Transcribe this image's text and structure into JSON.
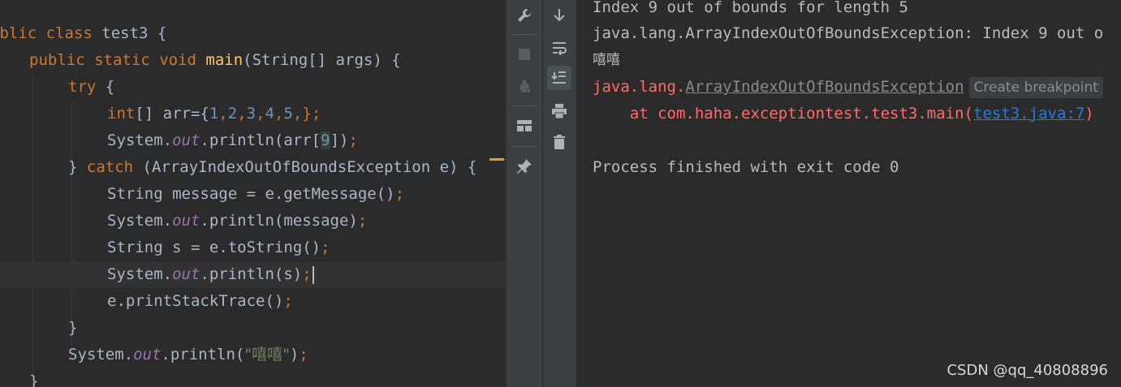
{
  "editor": {
    "lines": {
      "l1": {
        "a": "ublic",
        "b": " ",
        "c": "class",
        "d": " test3 {"
      },
      "l2": {
        "a": "public",
        "b": " ",
        "c": "static",
        "d": " ",
        "e": "void",
        "f": " ",
        "g": "main",
        "h": "(String[] args) {"
      },
      "l3": {
        "a": "try",
        "b": " {"
      },
      "l4": {
        "a": "int",
        "b": "[] arr={",
        "c": "1",
        "d": ",",
        "e": "2",
        "f": ",",
        "g": "3",
        "h": ",",
        "i": "4",
        "j": ",",
        "k": "5",
        "l": ",",
        "m": "};"
      },
      "l5": {
        "a": "System.",
        "b": "out",
        "c": ".println(arr[",
        "d": "9",
        "e": "])",
        "f": ";"
      },
      "l6": {
        "a": "} ",
        "b": "catch",
        "c": " (ArrayIndexOutOfBoundsException e) {"
      },
      "l7": {
        "a": "String message = e.getMessage()",
        "b": ";"
      },
      "l8": {
        "a": "System.",
        "b": "out",
        "c": ".println(message)",
        "d": ";"
      },
      "l9": {
        "a": "String s = e.toString()",
        "b": ";"
      },
      "l10": {
        "a": "System.",
        "b": "out",
        "c": ".println(s)",
        "d": ";"
      },
      "l11": {
        "a": "e.printStackTrace()",
        "b": ";"
      },
      "l12": {
        "a": "}"
      },
      "l13": {
        "a": "System.",
        "b": "out",
        "c": ".println(",
        "d": "\"嘻嘻\"",
        "e": ")",
        "f": ";"
      },
      "l14": {
        "a": "}"
      }
    }
  },
  "toolbar": {
    "icons": [
      "wrench-icon",
      "stop-icon",
      "debug-icon",
      "layout-icon",
      "pin-icon",
      "scroll-down-icon",
      "soft-wrap-icon",
      "scroll-to-end-icon",
      "print-icon",
      "trash-icon"
    ]
  },
  "console": {
    "line1": "Index 9 out of bounds for length 5",
    "line2": "java.lang.ArrayIndexOutOfBoundsException: Index 9 out o",
    "line3": "嘻嘻",
    "line4_prefix": "java.lang.",
    "line4_link": "ArrayIndexOutOfBoundsException",
    "line4_tooltip": "Create breakpoint",
    "line5_prefix": "    at com.haha.exceptiontest.test3.main(",
    "line5_link": "test3.java:7",
    "line5_suffix": ")",
    "line6": "Process finished with exit code 0"
  },
  "watermark": "CSDN @qq_40808896"
}
